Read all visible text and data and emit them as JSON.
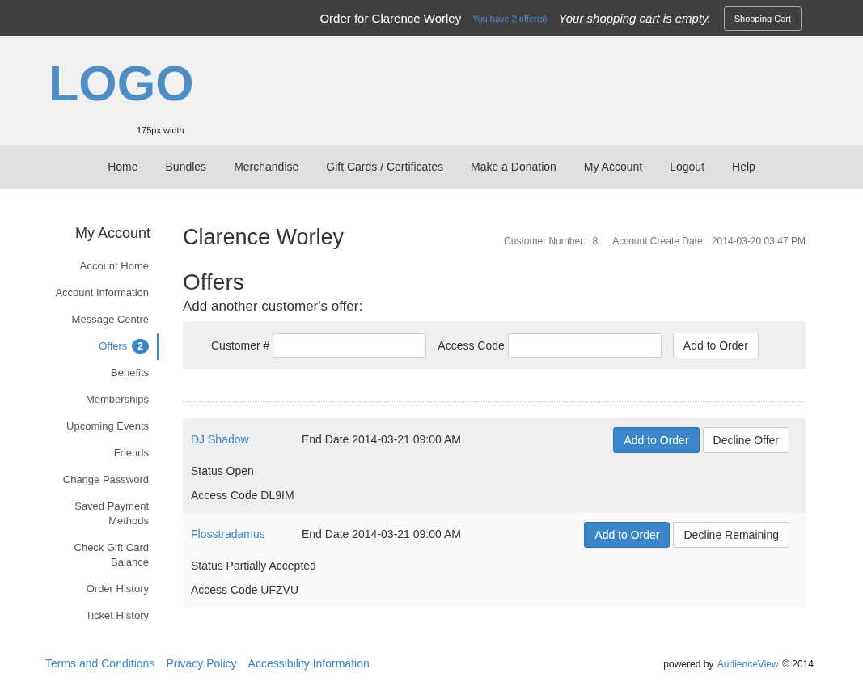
{
  "top_bar": {
    "order_for": "Order for Clarence Worley",
    "offers_link": "You have 2 offer(s)",
    "cart_status": "Your shopping cart is empty.",
    "cart_button": "Shopping Cart"
  },
  "header": {
    "logo": "LOGO",
    "logo_note": "175px width"
  },
  "nav": {
    "items": [
      "Home",
      "Bundles",
      "Merchandise",
      "Gift Cards / Certificates",
      "Make a Donation",
      "My Account",
      "Logout",
      "Help"
    ]
  },
  "sidebar": {
    "title": "My Account",
    "items": [
      {
        "label": "Account Home",
        "selected": false
      },
      {
        "label": "Account Information",
        "selected": false
      },
      {
        "label": "Message Centre",
        "selected": false
      },
      {
        "label": "Offers",
        "selected": true,
        "badge": "2"
      },
      {
        "label": "Benefits",
        "selected": false
      },
      {
        "label": "Memberships",
        "selected": false
      },
      {
        "label": "Upcoming Events",
        "selected": false
      },
      {
        "label": "Friends",
        "selected": false
      },
      {
        "label": "Change Password",
        "selected": false
      },
      {
        "label": "Saved Payment Methods",
        "selected": false
      },
      {
        "label": "Check Gift Card Balance",
        "selected": false
      },
      {
        "label": "Order History",
        "selected": false
      },
      {
        "label": "Ticket History",
        "selected": false
      }
    ]
  },
  "customer": {
    "name": "Clarence Worley",
    "number_label": "Customer Number:",
    "number": "8",
    "create_date_label": "Account Create Date:",
    "create_date": "2014-03-20 03:47 PM"
  },
  "offers": {
    "title": "Offers",
    "add_title": "Add another customer's offer:",
    "customer_label": "Customer #",
    "access_label": "Access Code",
    "add_button": "Add to Order",
    "items": [
      {
        "name": "DJ Shadow",
        "end_date": "End Date 2014-03-21 09:00 AM",
        "status": "Status Open",
        "access_code": "Access Code DL9IM",
        "buttons": [
          {
            "label": "Add to Order",
            "kind": "primary"
          },
          {
            "label": "Decline Offer",
            "kind": "default"
          }
        ]
      },
      {
        "name": "Flosstradamus",
        "end_date": "End Date 2014-03-21 09:00 AM",
        "status": "Status Partially Accepted",
        "access_code": "Access Code UFZVU",
        "buttons": [
          {
            "label": "Add to Order",
            "kind": "primary"
          },
          {
            "label": "Decline Remaining",
            "kind": "default"
          }
        ]
      }
    ]
  },
  "footer": {
    "links": [
      "Terms and Conditions",
      "Privacy Policy",
      "Accessibility Information"
    ],
    "powered_by": "powered by",
    "powered_link": "AudienceView",
    "copyright": "© 2014"
  }
}
